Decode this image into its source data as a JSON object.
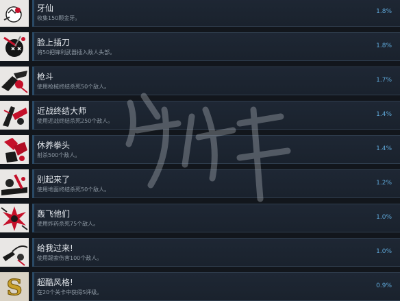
{
  "achievements": [
    {
      "title": "牙仙",
      "desc": "收集150颗金牙。",
      "pct": "1.8%",
      "icon": "tooth-icon"
    },
    {
      "title": "脸上插刀",
      "desc": "将50把锋利武器插入敌人头部。",
      "pct": "1.8%",
      "icon": "knife-head-icon"
    },
    {
      "title": "枪斗",
      "desc": "使用枪械终结杀死50个敌人。",
      "pct": "1.7%",
      "icon": "gun-fight-icon"
    },
    {
      "title": "近战终结大师",
      "desc": "使用近战终结杀死250个敌人。",
      "pct": "1.4%",
      "icon": "melee-icon"
    },
    {
      "title": "休养拳头",
      "desc": "射杀500个敌人。",
      "pct": "1.4%",
      "icon": "fist-icon"
    },
    {
      "title": "别起来了",
      "desc": "使用地面终结杀死50个敌人。",
      "pct": "1.2%",
      "icon": "ground-finish-icon"
    },
    {
      "title": "轰飞他们",
      "desc": "使用炸药杀死75个敌人。",
      "pct": "1.0%",
      "icon": "explosion-icon"
    },
    {
      "title": "给我过来!",
      "desc": "使用踢索伤害100个敌人。",
      "pct": "1.0%",
      "icon": "pull-icon"
    },
    {
      "title": "超酷风格!",
      "desc": "在20个关卡中获得S评级。",
      "pct": "0.9%",
      "icon": "gold-s-icon"
    }
  ],
  "colors": {
    "background": "#12161c",
    "card": "#1e2734",
    "percent": "#5fa8d9",
    "title": "#e3e7ec",
    "description": "#8f9aa5"
  }
}
